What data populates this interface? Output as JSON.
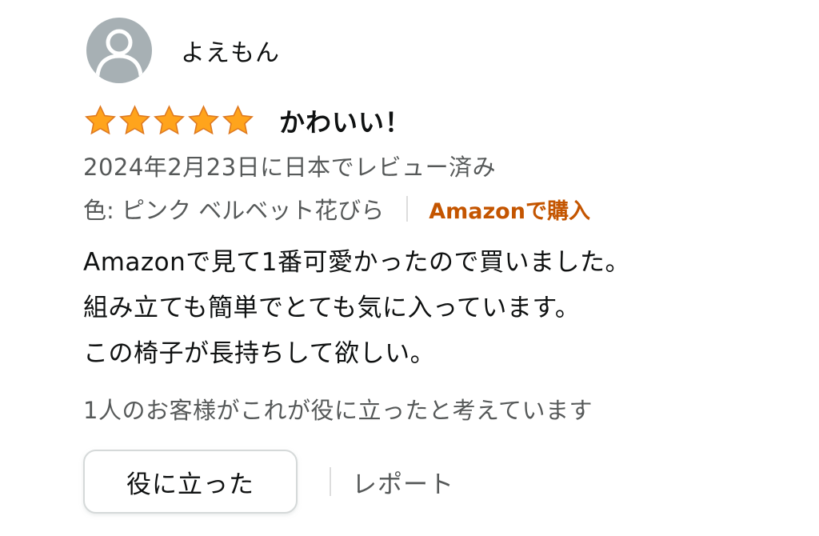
{
  "reviewer": {
    "name": "よえもん",
    "avatar_icon": "user-silhouette-icon"
  },
  "rating": {
    "stars": 5,
    "out_of": 5,
    "star_color": "#ffa41c",
    "star_icon": "star-icon"
  },
  "review": {
    "title": "かわいい！",
    "date": "2024年2月23日に日本でレビュー済み",
    "variant": "色: ピンク ベルベット花びら",
    "verified_label": "Amazonで購入",
    "body_lines": [
      "Amazonで見て1番可愛かったので買いました。",
      "組み立ても簡単でとても気に入っています。",
      "この椅子が長持ちして欲しい。"
    ]
  },
  "helpful_count_text": "1人のお客様がこれが役に立ったと考えています",
  "actions": {
    "helpful_button": "役に立った",
    "report_link": "レポート"
  },
  "colors": {
    "verified": "#c45500",
    "secondary_text": "#565959",
    "primary_text": "#0f1111",
    "avatar_bg": "#a7b0b4"
  }
}
